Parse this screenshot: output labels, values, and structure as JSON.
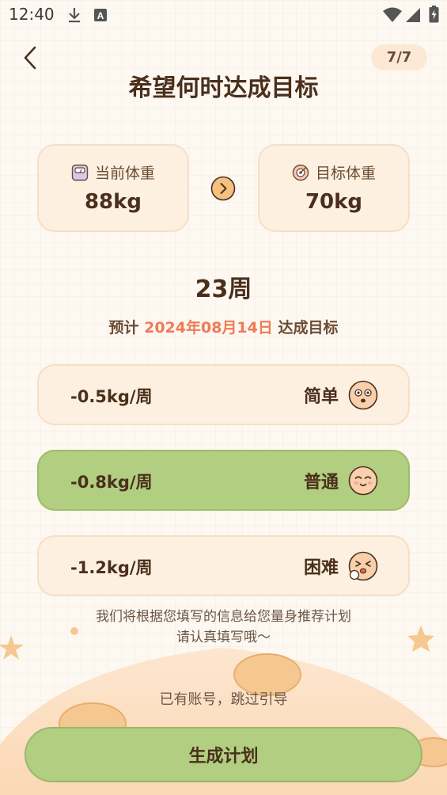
{
  "status_bar": {
    "time": "12:40",
    "icons": [
      "download-icon",
      "a-notification-icon",
      "wifi-icon",
      "signal-icon",
      "battery-charging-icon"
    ]
  },
  "header": {
    "back_icon": "back-chevron-icon",
    "step": "7/7",
    "title": "希望何时达成目标"
  },
  "current_weight": {
    "icon": "scale-icon",
    "label": "当前体重",
    "value": "88kg"
  },
  "target_weight": {
    "icon": "target-icon",
    "label": "目标体重",
    "value": "70kg"
  },
  "arrow_icon": "arrow-right-circle-icon",
  "duration": "23周",
  "eta": {
    "prefix": "预计",
    "date": "2024年08月14日",
    "suffix": "达成目标"
  },
  "pace_options": [
    {
      "rate": "-0.5kg/周",
      "level": "简单",
      "icon": "amazed-face-icon",
      "selected": false
    },
    {
      "rate": "-0.8kg/周",
      "level": "普通",
      "icon": "smiling-face-icon",
      "selected": true
    },
    {
      "rate": "-1.2kg/周",
      "level": "困难",
      "icon": "sweating-face-icon",
      "selected": false
    }
  ],
  "hint": {
    "line1": "我们将根据您填写的信息给您量身推荐计划",
    "line2": "请认真填写哦～"
  },
  "skip_link": "已有账号，跳过引导",
  "generate_button": "生成计划",
  "colors": {
    "background": "#fdf8f1",
    "card": "#fdf0e0",
    "accent_green": "#b1ce81",
    "date_highlight": "#f07a55",
    "text_dark": "#4a2f1c"
  }
}
